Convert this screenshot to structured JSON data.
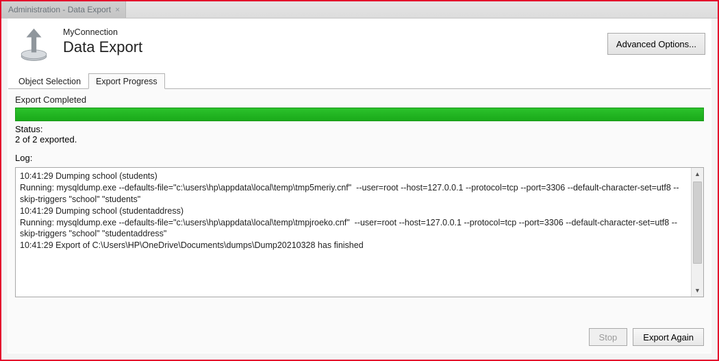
{
  "document_tab": {
    "label": "Administration - Data Export"
  },
  "header": {
    "connection": "MyConnection",
    "title": "Data Export",
    "advanced_button": "Advanced Options..."
  },
  "tabs": {
    "object_selection": "Object Selection",
    "export_progress": "Export Progress",
    "active": "export_progress"
  },
  "progress": {
    "title": "Export Completed",
    "status_label": "Status:",
    "status_value": "2 of 2 exported.",
    "percent": 100
  },
  "log": {
    "label": "Log:",
    "text": "10:41:29 Dumping school (students)\nRunning: mysqldump.exe --defaults-file=\"c:\\users\\hp\\appdata\\local\\temp\\tmp5meriy.cnf\"  --user=root --host=127.0.0.1 --protocol=tcp --port=3306 --default-character-set=utf8 --skip-triggers \"school\" \"students\"\n10:41:29 Dumping school (studentaddress)\nRunning: mysqldump.exe --defaults-file=\"c:\\users\\hp\\appdata\\local\\temp\\tmpjroeko.cnf\"  --user=root --host=127.0.0.1 --protocol=tcp --port=3306 --default-character-set=utf8 --skip-triggers \"school\" \"studentaddress\"\n10:41:29 Export of C:\\Users\\HP\\OneDrive\\Documents\\dumps\\Dump20210328 has finished"
  },
  "buttons": {
    "stop": "Stop",
    "export_again": "Export Again"
  }
}
